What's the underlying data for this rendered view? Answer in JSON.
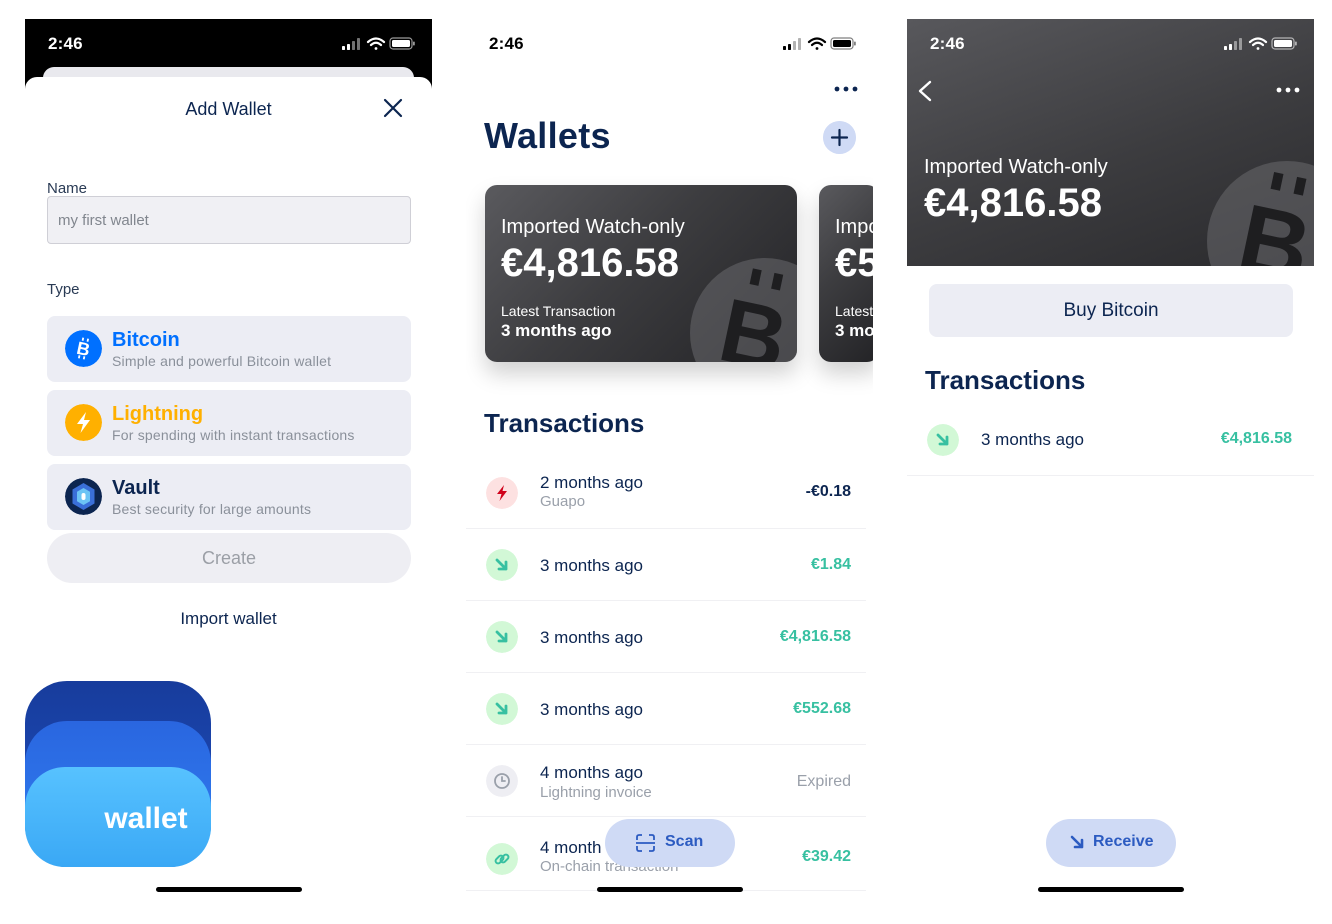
{
  "status_bar": {
    "time": "2:46"
  },
  "add_wallet": {
    "title": "Add Wallet",
    "name_label": "Name",
    "name_placeholder": "my first wallet",
    "type_label": "Type",
    "types": [
      {
        "title": "Bitcoin",
        "subtitle": "Simple and powerful Bitcoin wallet",
        "color": "#0070ff"
      },
      {
        "title": "Lightning",
        "subtitle": "For spending with instant transactions",
        "color": "#ffb000"
      },
      {
        "title": "Vault",
        "subtitle": "Best security for large amounts",
        "color": "#0c2550"
      }
    ],
    "create_label": "Create",
    "import_label": "Import wallet",
    "logo_text": "wallet"
  },
  "wallets": {
    "title": "Wallets",
    "card": {
      "label": "Imported Watch-only",
      "balance": "€4,816.58",
      "latest_label": "Latest Transaction",
      "latest_value": "3 months ago"
    },
    "card_peek": {
      "label": "Impo",
      "balance": "€5",
      "latest_label": "Latest",
      "latest_value": "3 mo"
    },
    "transactions_title": "Transactions",
    "transactions": [
      {
        "time": "2 months ago",
        "memo": "Guapo",
        "amount": "-€0.18",
        "kind": "lightning-out"
      },
      {
        "time": "3 months ago",
        "memo": "",
        "amount": "€1.84",
        "kind": "incoming"
      },
      {
        "time": "3 months ago",
        "memo": "",
        "amount": "€4,816.58",
        "kind": "incoming"
      },
      {
        "time": "3 months ago",
        "memo": "",
        "amount": "€552.68",
        "kind": "incoming"
      },
      {
        "time": "4 months ago",
        "memo": "Lightning invoice",
        "amount": "Expired",
        "kind": "expired"
      },
      {
        "time": "4 month",
        "memo": "On-chain transaction",
        "amount": "€39.42",
        "kind": "link"
      }
    ],
    "scan_label": "Scan"
  },
  "wallet_detail": {
    "label": "Imported Watch-only",
    "balance": "€4,816.58",
    "buy_label": "Buy Bitcoin",
    "transactions_title": "Transactions",
    "transactions": [
      {
        "time": "3 months ago",
        "amount": "€4,816.58"
      }
    ],
    "receive_label": "Receive"
  },
  "colors": {
    "navy": "#0c2550",
    "positive": "#37c0a1",
    "negative": "#0c2550",
    "accent_blue": "#2c5bc1"
  }
}
